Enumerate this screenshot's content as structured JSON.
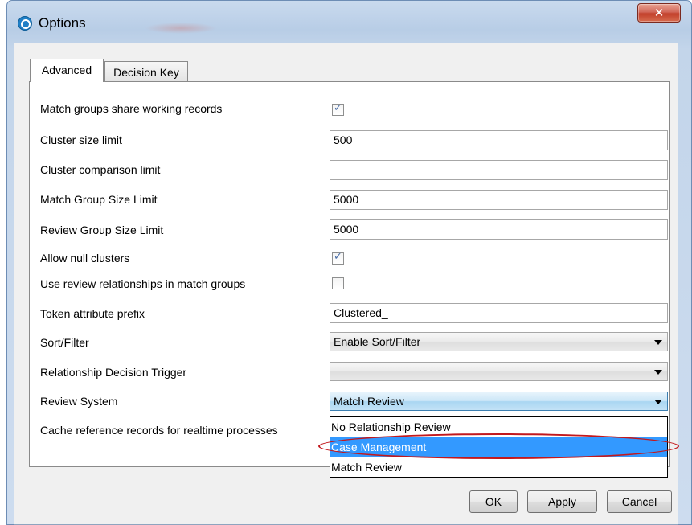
{
  "window": {
    "title": "Options",
    "close_glyph": "✕"
  },
  "tabs": [
    {
      "label": "Advanced",
      "active": true
    },
    {
      "label": "Decision Key",
      "active": false
    }
  ],
  "settings": {
    "share_working_records": {
      "label": "Match groups share working records",
      "checked": true
    },
    "cluster_size_limit": {
      "label": "Cluster size limit",
      "value": "500"
    },
    "cluster_comparison_limit": {
      "label": "Cluster comparison limit",
      "value": ""
    },
    "match_group_size_limit": {
      "label": "Match Group Size Limit",
      "value": "5000"
    },
    "review_group_size_limit": {
      "label": "Review Group Size Limit",
      "value": "5000"
    },
    "allow_null_clusters": {
      "label": "Allow null clusters",
      "checked": true
    },
    "use_review_relationships": {
      "label": "Use review relationships in match groups",
      "checked": false
    },
    "token_attribute_prefix": {
      "label": "Token attribute prefix",
      "value": "Clustered_"
    },
    "sort_filter": {
      "label": "Sort/Filter",
      "value": "Enable Sort/Filter"
    },
    "relationship_decision_trigger": {
      "label": "Relationship Decision Trigger",
      "value": ""
    },
    "review_system": {
      "label": "Review System",
      "value": "Match Review"
    },
    "cache_reference_records": {
      "label": "Cache reference records for realtime processes"
    }
  },
  "review_system_options": [
    {
      "label": "No Relationship Review",
      "highlighted": false
    },
    {
      "label": "Case Management",
      "highlighted": true
    },
    {
      "label": "Match Review",
      "highlighted": false
    }
  ],
  "buttons": {
    "ok": "OK",
    "apply": "Apply",
    "cancel": "Cancel"
  },
  "colors": {
    "selection": "#3399ff",
    "annotation": "#c2181d"
  },
  "icons": {
    "app": "app-logo-icon",
    "checkbox_check": "checkmark-icon",
    "dropdown": "chevron-down-icon"
  }
}
